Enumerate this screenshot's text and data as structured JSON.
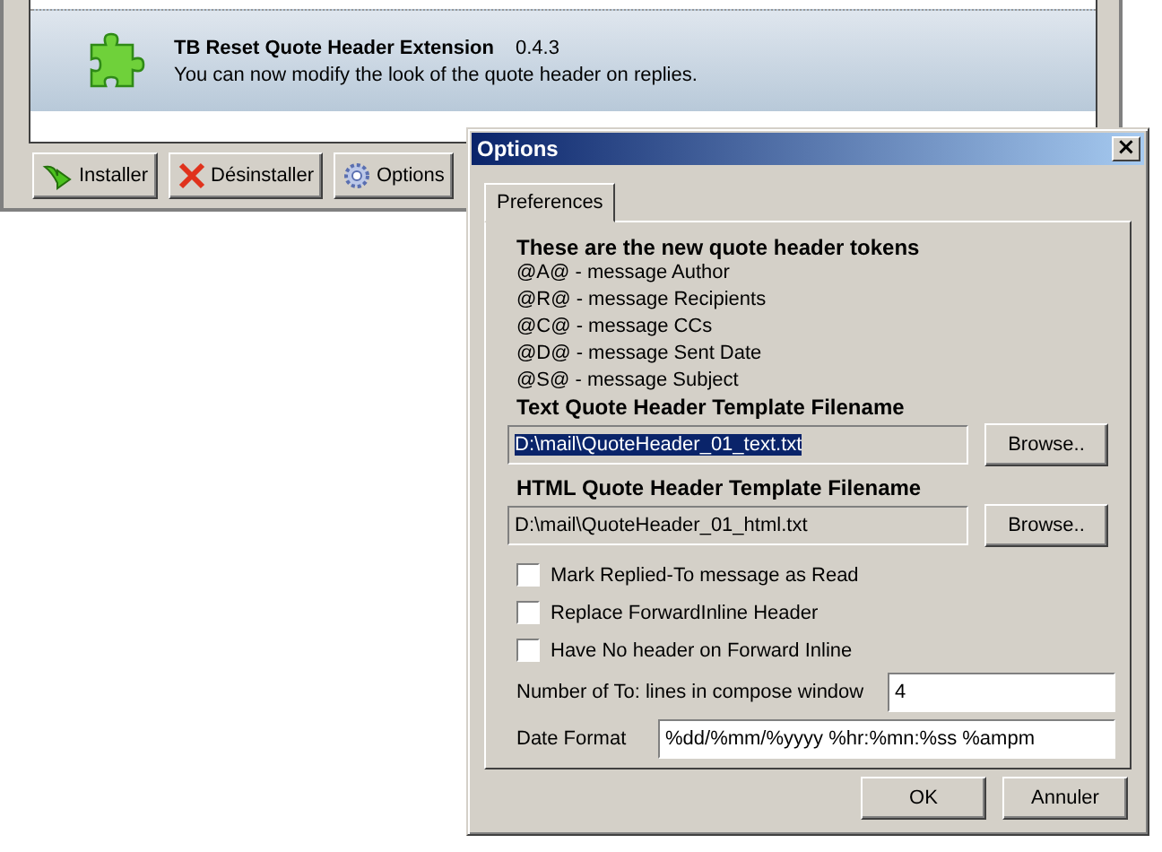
{
  "extension_manager": {
    "extension": {
      "name": "TB Reset Quote Header Extension",
      "version": "0.4.3",
      "description": "You can now modify the look of the quote header on replies.",
      "selected": true
    },
    "buttons": [
      {
        "label": "Installer",
        "kind": "install"
      },
      {
        "label": "Désinstaller",
        "kind": "uninstall"
      },
      {
        "label": "Options",
        "kind": "options"
      }
    ]
  },
  "dialog": {
    "title": "Options",
    "close": "×",
    "tabs": [
      {
        "label": "Preferences",
        "selected": true
      }
    ],
    "tokens_heading": "These are the new quote header tokens",
    "tokens": [
      "@A@ - message Author",
      "@R@ - message Recipients",
      "@C@ - message CCs",
      "@D@ - message Sent Date",
      "@S@ - message Subject"
    ],
    "files": [
      {
        "label": "Text Quote Header Template Filename",
        "value": "D:\\mail\\QuoteHeader_01_text.txt",
        "highlighted": true,
        "button": "Browse.."
      },
      {
        "label": "HTML Quote Header Template Filename",
        "value": "D:\\mail\\QuoteHeader_01_html.txt",
        "highlighted": false,
        "button": "Browse.."
      }
    ],
    "checkboxes": [
      {
        "label": "Mark Replied-To message as Read",
        "checked": false
      },
      {
        "label": "Replace ForwardInline Header",
        "checked": false
      },
      {
        "label": "Have No header on Forward Inline",
        "checked": false
      }
    ],
    "to_lines": {
      "label": "Number of To: lines in compose window",
      "value": "4"
    },
    "date_format": {
      "label": "Date Format",
      "value": "%dd/%mm/%yyyy %hr:%mn:%ss %ampm"
    },
    "buttons": [
      "OK",
      "Annuler"
    ]
  }
}
